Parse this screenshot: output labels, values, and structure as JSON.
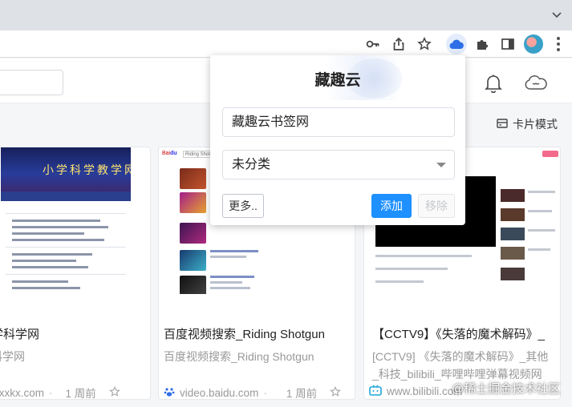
{
  "browser": {
    "tab_menu_icon": "chevron-down-icon",
    "toolbar_icons": [
      "key-icon",
      "share-icon",
      "star-icon",
      "extension-cloud-icon",
      "puzzle-icon",
      "sidebar-icon",
      "profile-avatar",
      "more-icon"
    ]
  },
  "page": {
    "view_mode_label": "卡片模式",
    "cards": [
      {
        "thumb_banner": "小学科学教学网",
        "title": "学科学网",
        "desc": "科学网",
        "domain": "zjxxkx.com",
        "time": "1 周前"
      },
      {
        "thumb_brand": "Riding Shotgun",
        "title": "百度视频搜索_Riding Shotgun",
        "desc": "百度视频搜索_Riding Shotgun",
        "domain": "video.baidu.com",
        "time": "1 周前"
      },
      {
        "title": "【CCTV9】《失落的魔术解码》_",
        "desc_line1": "[CCTV9] 《失落的魔术解码》_其他",
        "desc_line2": "_科技_bilibili_哔哩哔哩弹幕视频网",
        "domain": "www.bilibili.com"
      }
    ]
  },
  "popup": {
    "title": "藏趣云",
    "bookmark_title_value": "藏趣云书签网",
    "category_selected": "未分类",
    "more_label": "更多..",
    "add_label": "添加",
    "remove_label": "移除"
  },
  "watermark": "@稀土掘金技术社区",
  "colors": {
    "accent": "#1e90ff",
    "tabstrip": "#dee1e6"
  }
}
